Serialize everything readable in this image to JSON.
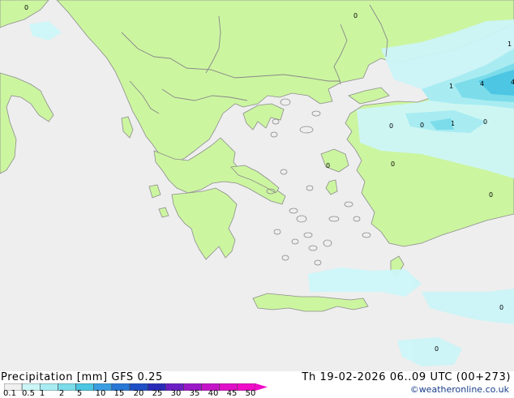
{
  "map": {
    "rain_labels": [
      "0",
      "0",
      "1",
      "4",
      "4",
      "1",
      "0",
      "0",
      "1",
      "0",
      "0",
      "0",
      "0",
      "0",
      "0"
    ]
  },
  "footer": {
    "title": "Precipitation [mm]  GFS 0.25",
    "datetime": "Th 19-02-2026 06..09 UTC (00+273)",
    "credit": "©weatheronline.co.uk"
  },
  "legend": {
    "ticks": [
      "0.1",
      "0.5",
      "1",
      "2",
      "5",
      "10",
      "15",
      "20",
      "25",
      "30",
      "35",
      "40",
      "45",
      "50"
    ],
    "colors": [
      "#f0f0f0",
      "#ccf5f8",
      "#a8ecf2",
      "#7cdcea",
      "#4cc6e2",
      "#3a9ee0",
      "#2a78d6",
      "#1f4fc6",
      "#2a2ab8",
      "#6a1ec4",
      "#9a18c8",
      "#c414c8",
      "#e010c8",
      "#f00cc8"
    ],
    "arrow_color": "#f00cc8"
  },
  "colors": {
    "sea": "#eeeeee",
    "land": "#ccf5a0",
    "border": "#888888",
    "coast": "#8c8c8c"
  }
}
